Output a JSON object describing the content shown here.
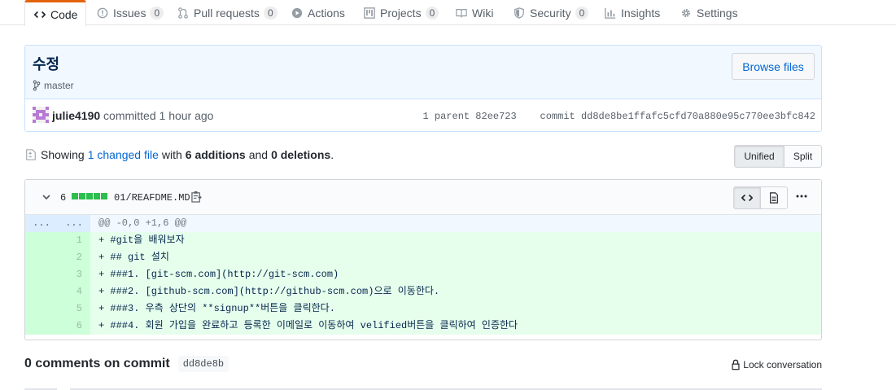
{
  "tabs": [
    {
      "label": "Code",
      "count": null,
      "icon": "code-icon"
    },
    {
      "label": "Issues",
      "count": "0",
      "icon": "issue-icon"
    },
    {
      "label": "Pull requests",
      "count": "0",
      "icon": "pull-request-icon"
    },
    {
      "label": "Actions",
      "count": null,
      "icon": "play-icon"
    },
    {
      "label": "Projects",
      "count": "0",
      "icon": "project-icon"
    },
    {
      "label": "Wiki",
      "count": null,
      "icon": "book-icon"
    },
    {
      "label": "Security",
      "count": "0",
      "icon": "shield-icon"
    },
    {
      "label": "Insights",
      "count": null,
      "icon": "graph-icon"
    },
    {
      "label": "Settings",
      "count": null,
      "icon": "gear-icon"
    }
  ],
  "commit": {
    "title": "수정",
    "branch": "master",
    "browse_label": "Browse files",
    "author": "julie4190",
    "action": "committed",
    "time": "1 hour ago",
    "parent_label": "1 parent",
    "parent_sha": "82ee723",
    "commit_label": "commit",
    "commit_sha": "dd8de8be1ffafc5cfd70a880e95c770ee3bfc842"
  },
  "toc": {
    "showing": "Showing",
    "changed": "1 changed file",
    "with": "with",
    "additions": "6 additions",
    "and": "and",
    "deletions": "0 deletions",
    "period": "."
  },
  "view_toggle": {
    "unified": "Unified",
    "split": "Split"
  },
  "file": {
    "change_count": "6",
    "name": "01/REAFDME.MD",
    "hunk_left": "...",
    "hunk_right": "...",
    "hunk_header": "@@ -0,0 +1,6 @@",
    "lines": [
      {
        "num": "1",
        "text": "+ #git을 배워보자"
      },
      {
        "num": "2",
        "text": "+ ## git 설치"
      },
      {
        "num": "3",
        "text": "+ ###1. [git-scm.com](http://git-scm.com)"
      },
      {
        "num": "4",
        "text": "+ ###2. [github-scm.com](http://github-scm.com)으로 이동한다."
      },
      {
        "num": "5",
        "text": "+ ###3. 우측 상단의 **signup**버튼을 클릭한다."
      },
      {
        "num": "6",
        "text": "+ ###4. 회원 가입을 완료하고 등록한 이메일로 이동하여 velified버튼을 클릭하여 인증한다"
      }
    ]
  },
  "comments": {
    "label": "0 comments on commit",
    "sha": "dd8de8b",
    "lock_label": "Lock conversation"
  },
  "colors": {
    "accent_tab": "#e36209",
    "link": "#0366d6",
    "addition": "#2cbe4e",
    "added_bg": "#e6ffed"
  }
}
